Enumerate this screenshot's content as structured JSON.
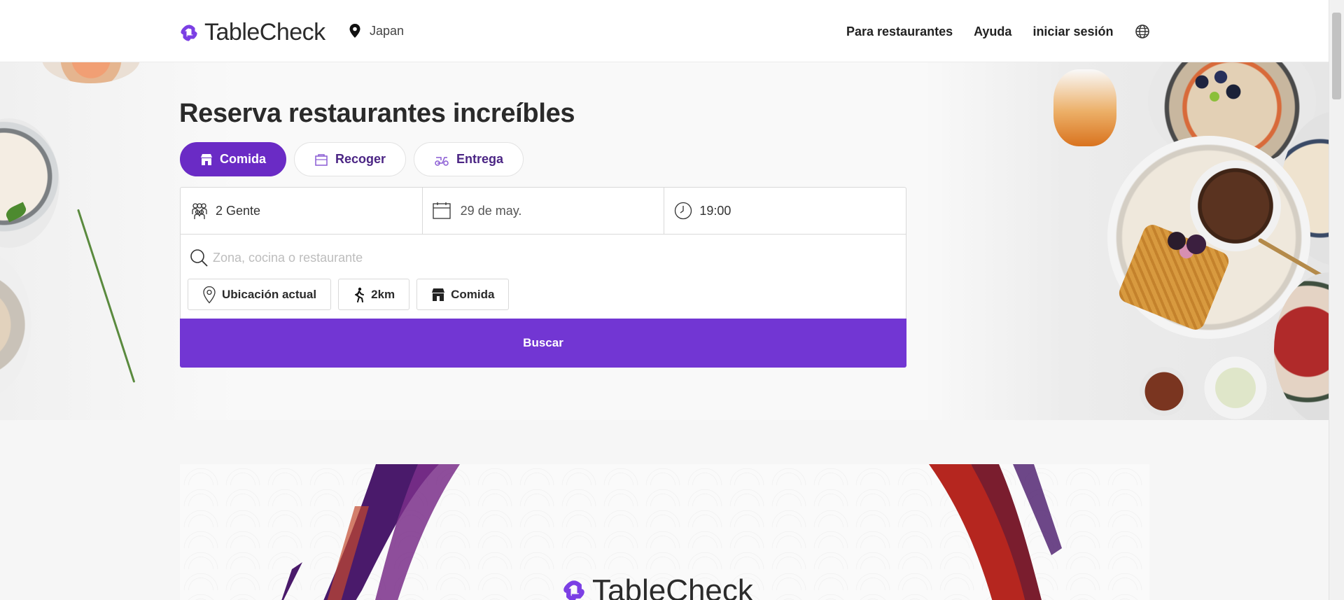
{
  "header": {
    "brand": "TableCheck",
    "location": "Japan",
    "nav": [
      "Para restaurantes",
      "Ayuda",
      "iniciar sesión"
    ]
  },
  "hero": {
    "title": "Reserva restaurantes increíbles",
    "tabs": [
      {
        "label": "Comida",
        "icon": "store-icon",
        "active": true
      },
      {
        "label": "Recoger",
        "icon": "bag-icon",
        "active": false
      },
      {
        "label": "Entrega",
        "icon": "scooter-icon",
        "active": false
      }
    ],
    "party": "2 Gente",
    "date": "29 de may.",
    "time": "19:00",
    "search_placeholder": "Zona, cocina o restaurante",
    "filters": [
      {
        "label": "Ubicación actual",
        "icon": "location-pin-icon"
      },
      {
        "label": "2km",
        "icon": "walking-icon"
      },
      {
        "label": "Comida",
        "icon": "store-icon"
      }
    ],
    "search_button": "Buscar"
  },
  "banner": {
    "brand": "TableCheck"
  },
  "colors": {
    "primary": "#6a2bc5",
    "button": "#7236d3",
    "tab_text": "#4b2584"
  }
}
